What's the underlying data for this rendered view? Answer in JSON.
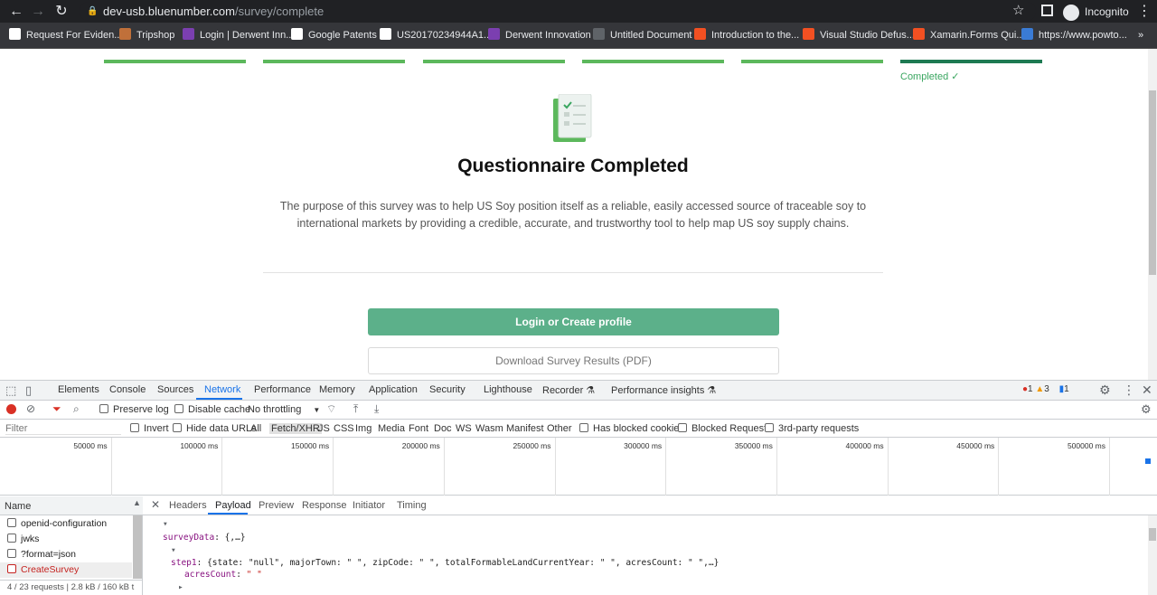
{
  "browser": {
    "url_host": "dev-usb.bluenumber.com",
    "url_path": "/survey/complete",
    "profile_label": "Incognito",
    "bookmarks": [
      {
        "label": "Request For Eviden...",
        "icon": "wikipedia-icon",
        "color": "#ffffff"
      },
      {
        "label": "Tripshop",
        "icon": "tripshop-icon",
        "color": "#c0703a"
      },
      {
        "label": "Login | Derwent Inn...",
        "icon": "derwent-icon",
        "color": "#7b3fb0"
      },
      {
        "label": "Google Patents",
        "icon": "google-icon",
        "color": "#ffffff"
      },
      {
        "label": "US20170234944A1...",
        "icon": "google-icon",
        "color": "#ffffff"
      },
      {
        "label": "Derwent Innovation",
        "icon": "derwent-icon",
        "color": "#7b3fb0"
      },
      {
        "label": "Untitled Document",
        "icon": "globe-icon",
        "color": "#5f6368"
      },
      {
        "label": "Introduction to the...",
        "icon": "microsoft-icon",
        "color": "#f25022"
      },
      {
        "label": "Visual Studio Defus...",
        "icon": "microsoft-icon",
        "color": "#f25022"
      },
      {
        "label": "Xamarin.Forms Qui...",
        "icon": "microsoft-icon",
        "color": "#f25022"
      },
      {
        "label": "https://www.powto...",
        "icon": "powtoon-icon",
        "color": "#3a7bd5"
      }
    ],
    "bookmarks_more": "»"
  },
  "page": {
    "steps_total": 6,
    "completed_label": "Completed ✓",
    "title": "Questionnaire Completed",
    "description": "The purpose of this survey was to help US Soy position itself as a reliable, easily accessed source of traceable soy to international markets by providing a credible, accurate, and trustworthy tool to help map US soy supply chains.",
    "login_button": "Login or Create profile",
    "download_button": "Download Survey Results (PDF)",
    "accent_color": "#5cb08a"
  },
  "devtools": {
    "tabs": [
      "Elements",
      "Console",
      "Sources",
      "Network",
      "Performance",
      "Memory",
      "Application",
      "Security",
      "Lighthouse",
      "Recorder ⚗",
      "Performance insights ⚗"
    ],
    "active_tab": "Network",
    "error_count": "1",
    "warning_count": "3",
    "message_count": "1",
    "toolbar": {
      "preserve_log": "Preserve log",
      "disable_cache": "Disable cache",
      "throttling": "No throttling"
    },
    "filter_bar": {
      "placeholder": "Filter",
      "invert": "Invert",
      "hide_data_urls": "Hide data URLs",
      "types": [
        "All",
        "Fetch/XHR",
        "JS",
        "CSS",
        "Img",
        "Media",
        "Font",
        "Doc",
        "WS",
        "Wasm",
        "Manifest",
        "Other"
      ],
      "active_type": "Fetch/XHR",
      "has_blocked_cookies": "Has blocked cookies",
      "blocked_requests": "Blocked Requests",
      "third_party": "3rd-party requests"
    },
    "timeline_labels": [
      "50000 ms",
      "100000 ms",
      "150000 ms",
      "200000 ms",
      "250000 ms",
      "300000 ms",
      "350000 ms",
      "400000 ms",
      "450000 ms",
      "500000 ms"
    ],
    "requests_header": "Name",
    "requests": [
      "openid-configuration",
      "jwks",
      "?format=json",
      "CreateSurvey"
    ],
    "selected_request": "CreateSurvey",
    "requests_footer": "4 / 23 requests  |  2.8 kB / 160 kB t",
    "detail_tabs": [
      "Headers",
      "Payload",
      "Preview",
      "Response",
      "Initiator",
      "Timing"
    ],
    "active_detail_tab": "Payload",
    "payload": {
      "line1_key": "surveyData",
      "line1_val": "{,…}",
      "line2_key": "step1",
      "line2_val": "{state: \"null\", majorTown: \" \", zipCode: \" \", totalFormableLandCurrentYear: \" \", acresCount: \" \",…}",
      "line3_key": "acresCount",
      "line3_val": "\" \""
    }
  }
}
